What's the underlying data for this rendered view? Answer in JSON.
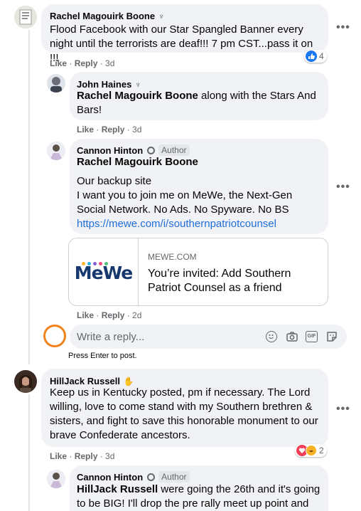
{
  "comments": [
    {
      "name": "Rachel Magouirk Boone",
      "text": "Flood Facebook with our Star Spangled Banner every night until the terrorists are deaf!!! 7 pm CST...pass it on !!!",
      "like": "Like",
      "reply": "Reply",
      "time": "3d",
      "reactions": "4"
    },
    {
      "name": "John Haines",
      "mention": "Rachel Magouirk Boone",
      "text": " along with the Stars And Bars!",
      "like": "Like",
      "reply": "Reply",
      "time": "3d"
    },
    {
      "name": "Cannon Hinton",
      "badge": "Author",
      "mention": "Rachel Magouirk Boone",
      "line1": "Our backup site",
      "line2": "I want you to join me on MeWe, the Next-Gen Social Network. No Ads. No Spyware. No BS",
      "link": "https://mewe.com/i/southernpatriotcounsel",
      "card_domain": "MEWE.COM",
      "card_title": "You’re invited: Add Southern Patriot Counsel as a friend",
      "card_logo": "MeWe",
      "like": "Like",
      "reply": "Reply",
      "time": "2d"
    },
    {
      "name": "HillJack Russell",
      "text": "Keep us in Kentucky posted, pm if necessary. The Lord willing, love to come stand with my Southern brethren & sisters, and fight to save this honorable monument to our brave Confederate ancestors.",
      "like": "Like",
      "reply": "Reply",
      "time": "3d",
      "reactions": "2"
    },
    {
      "name": "Cannon Hinton",
      "badge": "Author",
      "mention": "HillJack Russell",
      "text": " were going the 26th and it's going to be BIG! I'll drop the pre rally meet up point and"
    }
  ],
  "reply_box": {
    "placeholder": "Write a reply...",
    "hint": "Press Enter to post."
  },
  "colors": {
    "bubble": "#f0f2f5",
    "link": "#216fdb",
    "like_blue": "#1877f2",
    "love_red": "#f33e58",
    "avatar_circle": "#f2821c"
  }
}
